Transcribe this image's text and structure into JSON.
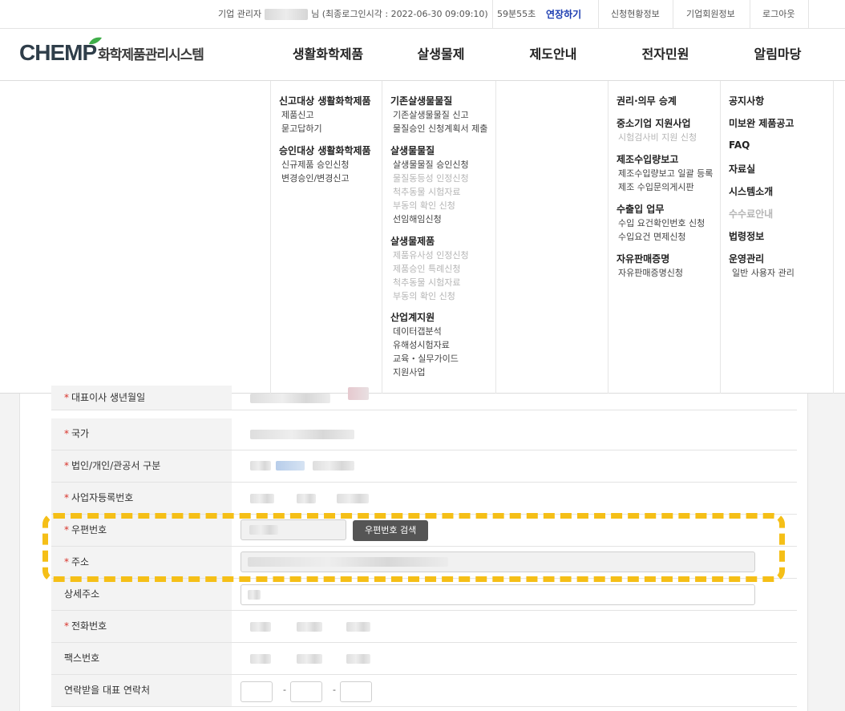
{
  "topbar": {
    "role_label": "기업 관리자",
    "name_suffix": "님",
    "last_login": "(최종로그인시각 : 2022-06-30 09:09:10)",
    "timer": "59분55초",
    "extend_label": "연장하기",
    "links": [
      "신청현황정보",
      "기업회원정보",
      "로그아웃"
    ]
  },
  "logo": {
    "brand_prefix": "CHEM",
    "brand_p": "P",
    "subtitle": "화학제품관리시스템"
  },
  "nav": [
    "생활화학제품",
    "살생물제",
    "제도안내",
    "전자민원",
    "알림마당"
  ],
  "mega": {
    "col1": {
      "groups": [
        {
          "title": "신고대상 생활화학제품",
          "items": [
            "제품신고",
            "묻고답하기"
          ]
        },
        {
          "title": "승인대상 생활화학제품",
          "items": [
            "신규제품 승인신청",
            "변경승인/변경신고"
          ]
        }
      ]
    },
    "col2": {
      "groups": [
        {
          "title": "기존살생물물질",
          "items": [
            "기존살생물물질 신고",
            "물질승인 신청계획서 제출"
          ]
        },
        {
          "title": "살생물물질",
          "items": [
            "살생물물질 승인신청",
            "물질동등성 인정신청",
            "척추동물 시험자료",
            "부동의 확인 신청",
            "선임해임신청"
          ]
        },
        {
          "title": "살생물제품",
          "items": [
            "제품유사성 인정신청",
            "제품승인 특례신청",
            "척추동물 시험자료",
            "부동의 확인 신청"
          ]
        },
        {
          "title": "산업계지원",
          "items": [
            "데이터갭분석",
            "유해성시험자료",
            "교육・실무가이드",
            "지원사업"
          ]
        }
      ]
    },
    "col4": {
      "groups": [
        {
          "title": "권리·의무 승계",
          "items": []
        },
        {
          "title": "중소기업 지원사업",
          "items": [
            "시험검사비 지원 신청"
          ]
        },
        {
          "title": "제조수입량보고",
          "items": [
            "제조수입량보고 일괄 등록",
            "제조 수입문의게시판"
          ]
        },
        {
          "title": "수출입 업무",
          "items": [
            "수입 요건확인번호 신청",
            "수입요건 면제신청"
          ]
        },
        {
          "title": "자유판매증명",
          "items": [
            "자유판매증명신청"
          ]
        }
      ]
    },
    "col5": {
      "items": [
        "공지사항",
        "미보완 제품공고",
        "FAQ",
        "자료실",
        "시스템소개",
        "수수료안내",
        "법령정보",
        "운영관리"
      ],
      "sub_item": "일반 사용자 관리"
    }
  },
  "form": {
    "rows": [
      {
        "label": "대표이사 생년월일",
        "required": true
      },
      {
        "label": "국가",
        "required": true
      },
      {
        "label": "법인/개인/관공서 구분",
        "required": true
      },
      {
        "label": "사업자등록번호",
        "required": true
      },
      {
        "label": "우편번호",
        "required": true
      },
      {
        "label": "주소",
        "required": true
      },
      {
        "label": "상세주소",
        "required": false
      },
      {
        "label": "전화번호",
        "required": true
      },
      {
        "label": "팩스번호",
        "required": false
      },
      {
        "label": "연락받을 대표 연락처",
        "required": false
      }
    ],
    "required_mark": "*",
    "zip_search_label": "우편번호 검색",
    "dash": "-"
  },
  "colors": {
    "accent_blue": "#1a3bb0",
    "required_red": "#d8322a",
    "highlight_yellow": "#f5bf17",
    "logo_green": "#3fae49"
  }
}
